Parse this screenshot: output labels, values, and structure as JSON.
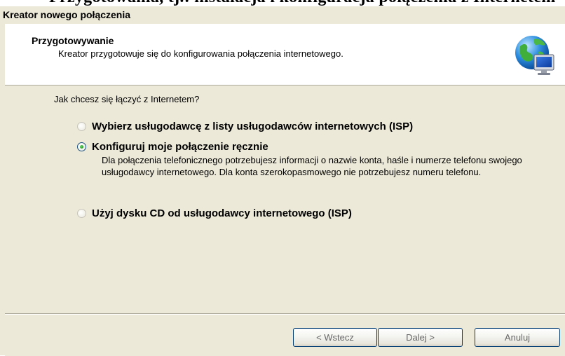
{
  "top_clip_text": "Przygotowania, tj.: instalacja i konfiguracja połączenia z Internetem",
  "window": {
    "title": "Kreator nowego połączenia"
  },
  "header": {
    "title": "Przygotowywanie",
    "subtitle": "Kreator przygotowuje się do konfigurowania połączenia internetowego.",
    "icon": "network-globe-monitor-icon"
  },
  "content": {
    "question": "Jak chcesz się łączyć z Internetem?",
    "options": [
      {
        "label": "Wybierz usługodawcę z listy usługodawców internetowych (ISP)",
        "selected": false
      },
      {
        "label": "Konfiguruj moje połączenie ręcznie",
        "selected": true
      },
      {
        "label": "Użyj dysku CD od usługodawcy internetowego (ISP)",
        "selected": false
      }
    ],
    "manual_description": "Dla połączenia telefonicznego potrzebujesz informacji o nazwie konta, haśle i numerze telefonu swojego usługodawcy internetowego. Dla konta szerokopasmowego nie potrzebujesz numeru telefonu."
  },
  "buttons": {
    "back": "< Wstecz",
    "next": "Dalej >",
    "cancel": "Anuluj"
  },
  "colors": {
    "dialog_background": "#ece9d8",
    "header_background": "#ffffff",
    "button_border": "#003c74",
    "radio_selected": "#21a121"
  }
}
